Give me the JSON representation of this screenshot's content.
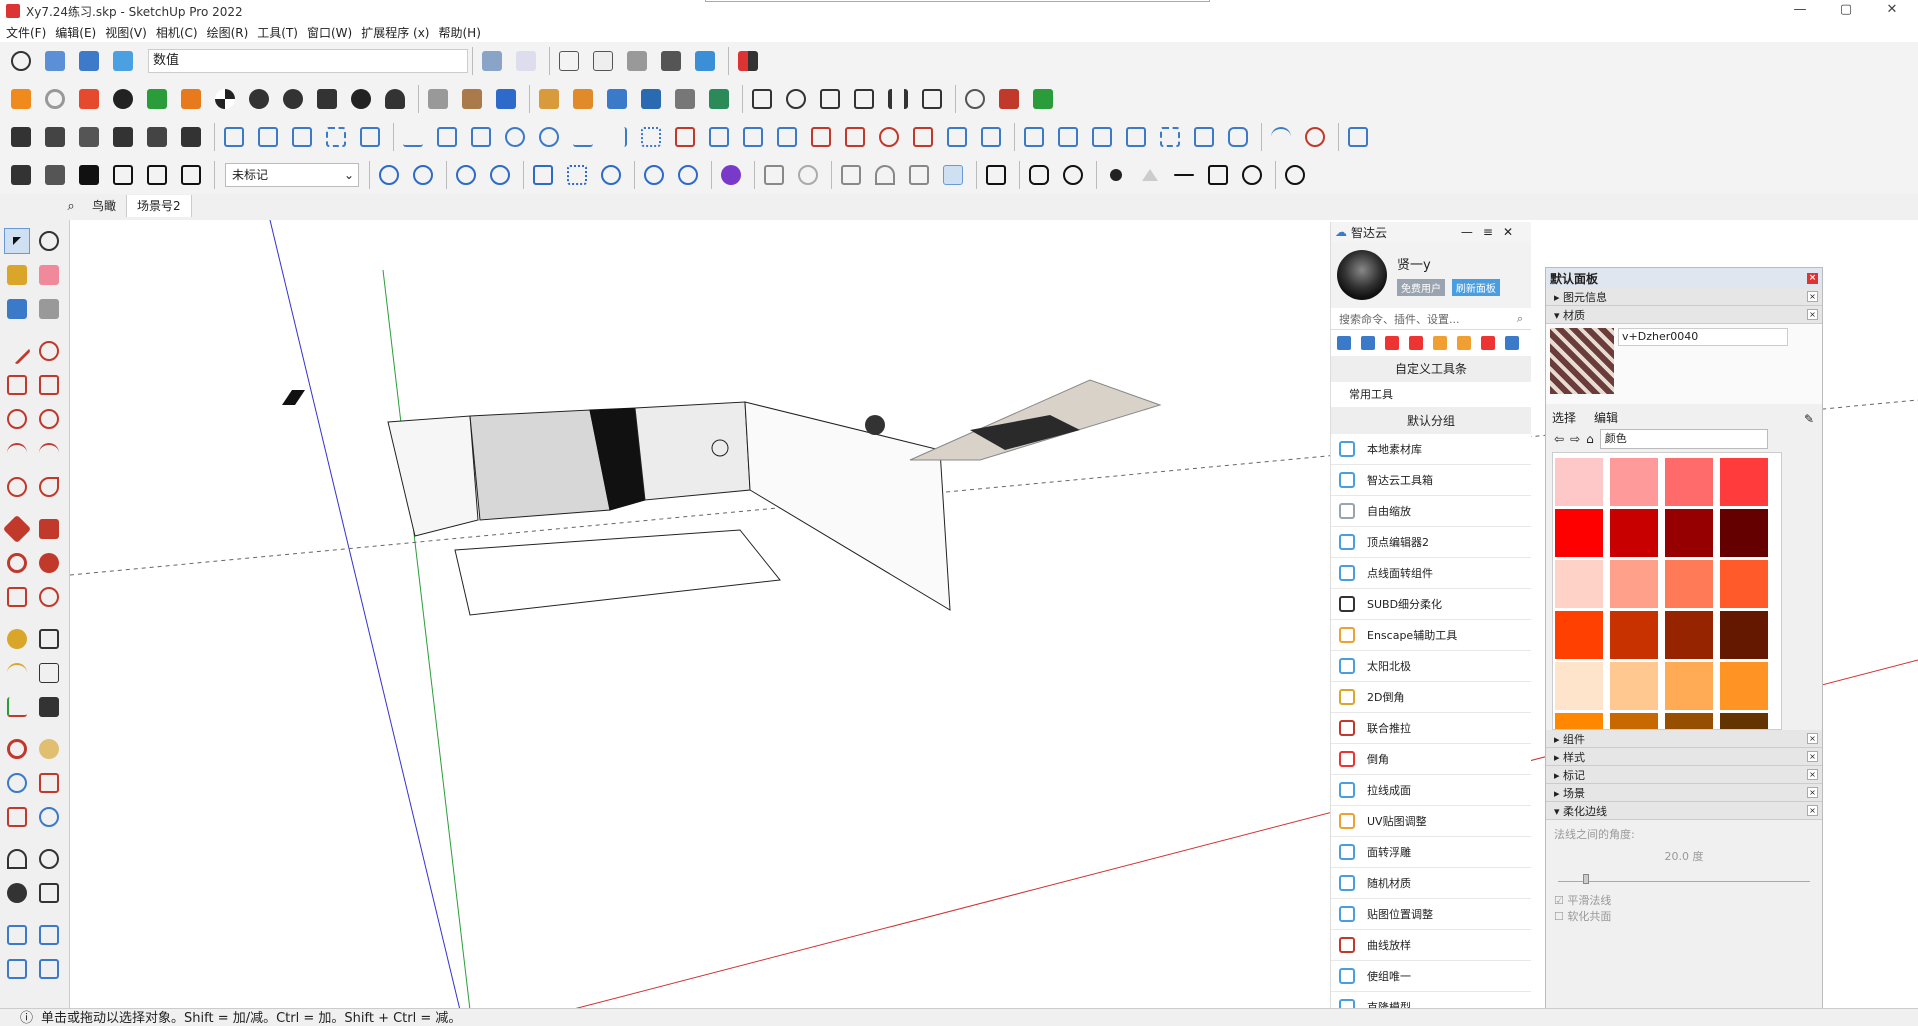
{
  "titlebar": {
    "title": "Xy7.24练习.skp - SketchUp Pro 2022",
    "minimize": "—",
    "maximize": "▢",
    "close": "✕"
  },
  "menu": [
    "文件(F)",
    "编辑(E)",
    "视图(V)",
    "相机(C)",
    "绘图(R)",
    "工具(T)",
    "窗口(W)",
    "扩展程序 (x)",
    "帮助(H)"
  ],
  "toolbar": {
    "measurements_label": "数值",
    "tag_select": "未标记"
  },
  "scenes": {
    "tabs": [
      "鸟瞰",
      "场景号2"
    ]
  },
  "status": {
    "hint": "单击或拖动以选择对象。Shift = 加/减。Ctrl = 加。Shift + Ctrl = 减。"
  },
  "zhidayun": {
    "title": "智达云",
    "username": "贤一y",
    "badges": [
      "免费用户",
      "刷新面板"
    ],
    "search_placeholder": "搜索命令、插件、设置...",
    "custom_toolbar": "自定义工具条",
    "common_tools": "常用工具",
    "default_group": "默认分组",
    "items": [
      "本地素材库",
      "智达云工具箱",
      "自由缩放",
      "顶点编辑器2",
      "点线面转组件",
      "SUBD细分柔化",
      "Enscape辅助工具",
      "太阳北极",
      "2D倒角",
      "联合推拉",
      "倒角",
      "拉线成面",
      "UV贴图调整",
      "面转浮雕",
      "随机材质",
      "贴图位置调整",
      "曲线放样",
      "使组唯一",
      "克隆模型"
    ]
  },
  "tray": {
    "title": "默认面板",
    "sections_top": [
      "图元信息",
      "材质"
    ],
    "material_name": "v+Dzher0040",
    "tabs": [
      "选择",
      "编辑"
    ],
    "category": "颜色",
    "sections_bottom": [
      "组件",
      "样式",
      "标记",
      "场景",
      "柔化边线"
    ],
    "soften": {
      "angle_label": "法线之间的角度:",
      "angle_value": "20.0",
      "angle_unit": "度",
      "smooth_normals": "平滑法线",
      "soften_coplanar": "软化共面"
    }
  },
  "swatch_colors": [
    "#ffc8c8",
    "#ff9a9a",
    "#ff6a6a",
    "#ff3b3b",
    "#ff0000",
    "#c80000",
    "#960000",
    "#640000",
    "#ffd2c8",
    "#ffa08a",
    "#ff7a56",
    "#ff5a2a",
    "#ff4000",
    "#c83200",
    "#962400",
    "#641800",
    "#ffe4cc",
    "#ffc890",
    "#ffaa54",
    "#ff9424",
    "#ff8800",
    "#c86800",
    "#964e00",
    "#643400"
  ],
  "icons": [
    "move-icon",
    "orbit-icon",
    "select-icon",
    "eraser-icon",
    "pencil-icon",
    "paint-icon",
    "tape-icon",
    "zoom-icon",
    "walk-icon",
    "search-icon"
  ]
}
